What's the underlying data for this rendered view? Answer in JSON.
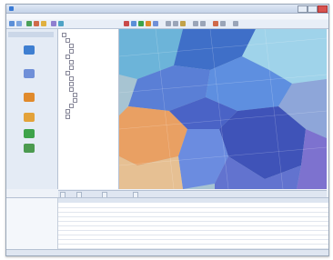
{
  "window": {
    "title": "",
    "buttons": [
      "minimize",
      "maximize",
      "close"
    ]
  },
  "menubar": {
    "items": [
      "",
      "",
      "",
      "",
      "",
      "",
      "",
      "",
      ""
    ]
  },
  "toolbar": {
    "buttons": [
      "open-icon",
      "save-icon",
      "zoom-in-icon",
      "zoom-out-icon",
      "pan-icon",
      "select-icon",
      "identify-icon",
      "measure-icon",
      "layer-icon",
      "refresh-icon",
      "print-icon",
      "help-icon"
    ]
  },
  "left_tools": {
    "header": "",
    "items": [
      {
        "icon": "ship-icon",
        "color": "#3f7fd1",
        "label": ""
      },
      {
        "icon": "layers-icon",
        "color": "#6f8fd8",
        "label": ""
      },
      {
        "icon": "chart-icon",
        "color": "#e08a2c",
        "label": ""
      },
      {
        "icon": "folder-icon",
        "color": "#e3a23a",
        "label": ""
      },
      {
        "icon": "tree-icon",
        "color": "#3da34a",
        "label": ""
      },
      {
        "icon": "globe-icon",
        "color": "#4b9a4f",
        "label": ""
      }
    ]
  },
  "tree": {
    "rows": [
      "",
      "",
      "",
      "",
      "",
      "",
      "",
      "",
      "",
      "",
      "",
      "",
      "",
      "",
      "",
      ""
    ]
  },
  "bottom_tabs": [
    "",
    "",
    "",
    ""
  ],
  "grid": {
    "left_rows": [
      "",
      "",
      ""
    ],
    "columns": [
      "",
      "",
      "",
      "",
      "",
      "",
      ""
    ],
    "rows": [
      [
        "",
        "",
        "",
        "",
        "",
        "",
        ""
      ],
      [
        "",
        "",
        "",
        "",
        "",
        "",
        ""
      ],
      [
        "",
        "",
        "",
        "",
        "",
        "",
        ""
      ],
      [
        "",
        "",
        "",
        "",
        "",
        "",
        ""
      ],
      [
        "",
        "",
        "",
        "",
        "",
        "",
        ""
      ],
      [
        "",
        "",
        "",
        "",
        "",
        "",
        ""
      ],
      [
        "",
        "",
        "",
        "",
        "",
        "",
        ""
      ],
      [
        "",
        "",
        "",
        "",
        "",
        "",
        ""
      ],
      [
        "",
        "",
        "",
        "",
        "",
        "",
        ""
      ],
      [
        "",
        "",
        "",
        "",
        "",
        "",
        ""
      ]
    ]
  },
  "status": {
    "text": ""
  },
  "colors": {
    "map_water": "#9fb9c9",
    "zone_dark_blue": "#3f53b8",
    "zone_blue": "#5a7fd6",
    "zone_cyan": "#6cb4d9",
    "zone_light_cyan": "#9fd3ea",
    "zone_orange": "#e9a063",
    "zone_peach": "#e6c093",
    "zone_purple": "#7d72cf",
    "zone_green": "#8fc48a",
    "zone_gray": "#b5b8c5"
  }
}
